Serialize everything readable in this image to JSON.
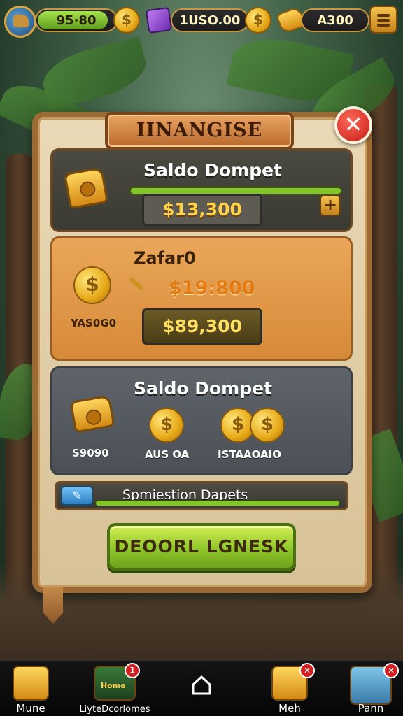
{
  "topbar": {
    "resource1_value": "95·80",
    "resource2_value": "1USO.00",
    "resource3_value": "A300",
    "resource1_fill_percent": 88,
    "resource2_fill_percent": 0,
    "resource3_fill_percent": 0
  },
  "panel": {
    "title": "IINANGISE",
    "close_symbol": "✕"
  },
  "card1": {
    "title": "Saldo Dompet",
    "value": "$13,300",
    "plus_symbol": "+"
  },
  "card2": {
    "title": "Zafar0",
    "price": "$19:800",
    "icon_label": "YAS0G0",
    "value": "$89,300"
  },
  "card3": {
    "title": "Saldo Dompet",
    "items": [
      {
        "label": "S9090"
      },
      {
        "label": "AUS OA"
      },
      {
        "label": "ISTAAOAIO"
      }
    ]
  },
  "slider": {
    "label": "Spmiestion Dapets",
    "fill_percent": 100
  },
  "cta": {
    "label": "DEOORL LGNESK"
  },
  "bottomnav": {
    "items": [
      {
        "label": "Mune",
        "badge": ""
      },
      {
        "label": "LiyteDcorlomes",
        "badge": "1",
        "icon_text": "Home"
      },
      {
        "label": "",
        "badge": ""
      },
      {
        "label": "Meh",
        "badge": "✕"
      },
      {
        "label": "Pann",
        "badge": "✕"
      }
    ]
  },
  "colors": {
    "accent_green": "#84c62a",
    "gold": "#ffd24a",
    "frame_brown": "#9c6a34",
    "close_red": "#c41a12"
  },
  "icons": [
    "hat-avatar-icon",
    "coin-icon",
    "gem-icon",
    "key-icon",
    "menu-icon",
    "close-icon",
    "treasure-chest-icon",
    "plus-icon",
    "wand-icon",
    "camera-chest-icon",
    "tools-icon",
    "crate-icon",
    "home-icon",
    "character-icon"
  ]
}
